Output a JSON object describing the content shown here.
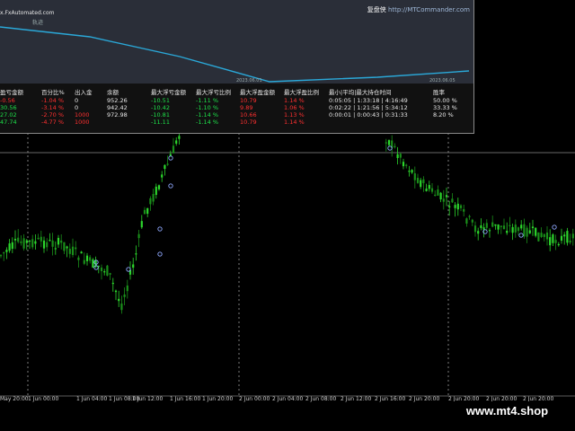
{
  "report": {
    "source": "x.FxAutomated.com",
    "track_label": "轨迹",
    "brand_name": "复盘侠",
    "brand_url": "http://MTCommander.com",
    "date_start": "2023.06.01",
    "date_end": "2023.06.05",
    "headers": [
      "盈亏金额",
      "百分比%",
      "出入金",
      "余额",
      "最大浮亏金额",
      "最大浮亏比例",
      "最大浮盈金额",
      "最大浮盈比例",
      "最小|平均|最大持仓时间",
      "胜率"
    ],
    "rows": [
      {
        "pnl": "-0.56",
        "pct": "-1.04 %",
        "flow": "0",
        "balance": "952.26",
        "dd_amt": "-10.51",
        "dd_pct": "-1.11 %",
        "fp_amt": "10.79",
        "fp_pct": "1.14 %",
        "hold": "0:05:05 | 1:33:18 | 4:16:49",
        "win": "50.00 %"
      },
      {
        "pnl": "30.56",
        "pct": "-3.14 %",
        "flow": "0",
        "balance": "942.42",
        "dd_amt": "-10.42",
        "dd_pct": "-1.10 %",
        "fp_amt": "9.89",
        "fp_pct": "1.06 %",
        "hold": "0:02:22 | 1:21:56 | 5:34:12",
        "win": "33.33 %"
      },
      {
        "pnl": "27.02",
        "pct": "-2.70 %",
        "flow": "1000",
        "balance": "972.98",
        "dd_amt": "-10.81",
        "dd_pct": "-1.14 %",
        "fp_amt": "10.66",
        "fp_pct": "1.13 %",
        "hold": "0:00:01 | 0:00:43 | 0:31:33",
        "win": "8.20 %"
      },
      {
        "pnl": "47.74",
        "pct": "-4.77 %",
        "flow": "1000",
        "balance": "",
        "dd_amt": "-11.11",
        "dd_pct": "-1.14 %",
        "fp_amt": "10.79",
        "fp_pct": "1.14 %",
        "hold": "",
        "win": ""
      }
    ]
  },
  "xaxis_labels": [
    "May 20:00",
    "1 Jun 00:00",
    "1 Jun 04:00",
    "1 Jun 08:00",
    "1 Jun 12:00",
    "1 Jun 16:00",
    "1 Jun 20:00",
    "2 Jun 00:00",
    "2 Jun 04:00",
    "2 Jun 08:00",
    "2 Jun 12:00",
    "2 Jun 16:00",
    "2 Jun 20:00",
    "2 Jun 20:00",
    "2 Jun 20:00",
    "2 Jun 20:00"
  ],
  "watermark": "www.mt4.shop",
  "colors": {
    "bull": "#2cd62c",
    "bear": "#1a8f1a",
    "curve": "#2aa8d8",
    "grid": "#9a9a9a",
    "panel_text": "#d8d8d8",
    "pos": "#1ee34a",
    "neg": "#ff3030"
  }
}
